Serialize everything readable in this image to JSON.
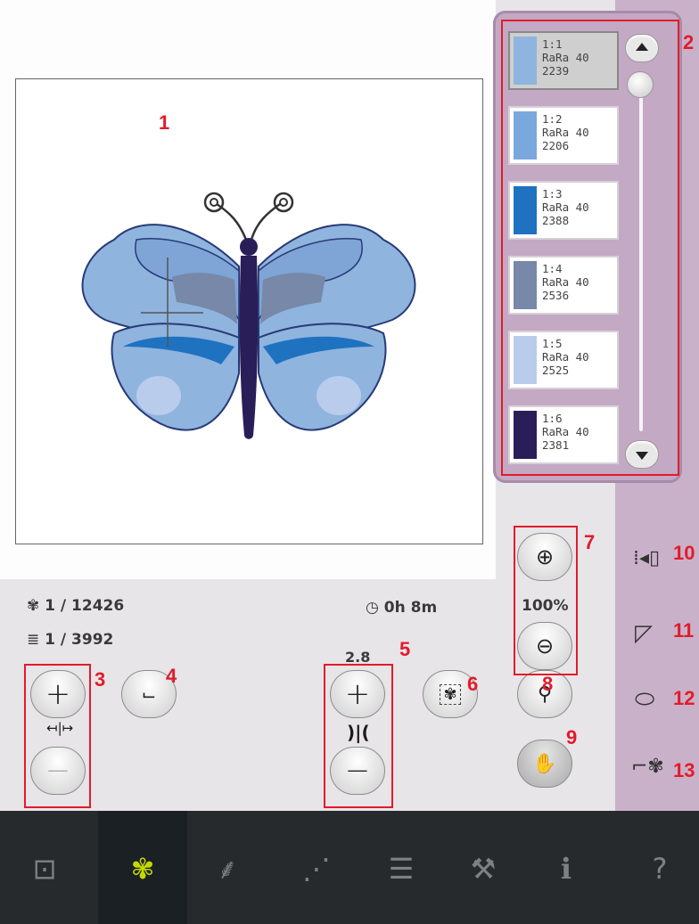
{
  "callouts": [
    "1",
    "2",
    "3",
    "4",
    "5",
    "6",
    "7",
    "8",
    "9",
    "10",
    "11",
    "12",
    "13"
  ],
  "thread_list": [
    {
      "label": "1:1",
      "brand": "RaRa 40",
      "number": "2239",
      "color": "#8fb4de",
      "selected": true
    },
    {
      "label": "1:2",
      "brand": "RaRa 40",
      "number": "2206",
      "color": "#7aa8dc",
      "selected": false
    },
    {
      "label": "1:3",
      "brand": "RaRa 40",
      "number": "2388",
      "color": "#1f72c0",
      "selected": false
    },
    {
      "label": "1:4",
      "brand": "RaRa 40",
      "number": "2536",
      "color": "#7788a8",
      "selected": false
    },
    {
      "label": "1:5",
      "brand": "RaRa 40",
      "number": "2525",
      "color": "#b9ccec",
      "selected": false
    },
    {
      "label": "1:6",
      "brand": "RaRa 40",
      "number": "2381",
      "color": "#2a1e58",
      "selected": false
    }
  ],
  "status": {
    "stitch_count": "1 / 12426",
    "color_block": "1 / 3992",
    "time": "0h 8m"
  },
  "controls": {
    "stitch_width_value": "2.8",
    "zoom_level": "100%"
  },
  "colors": {
    "accent_red": "#e21b2b",
    "palette_bg": "#c3a9c4",
    "active_tab": "#c4d900"
  },
  "icons": {
    "bottom_tabs": [
      "sewing-mode-icon",
      "embroidery-edit-icon",
      "stitch-menu-icon",
      "stitch-program-icon",
      "settings-list-icon",
      "tools-icon",
      "info-icon",
      "help-icon"
    ]
  }
}
